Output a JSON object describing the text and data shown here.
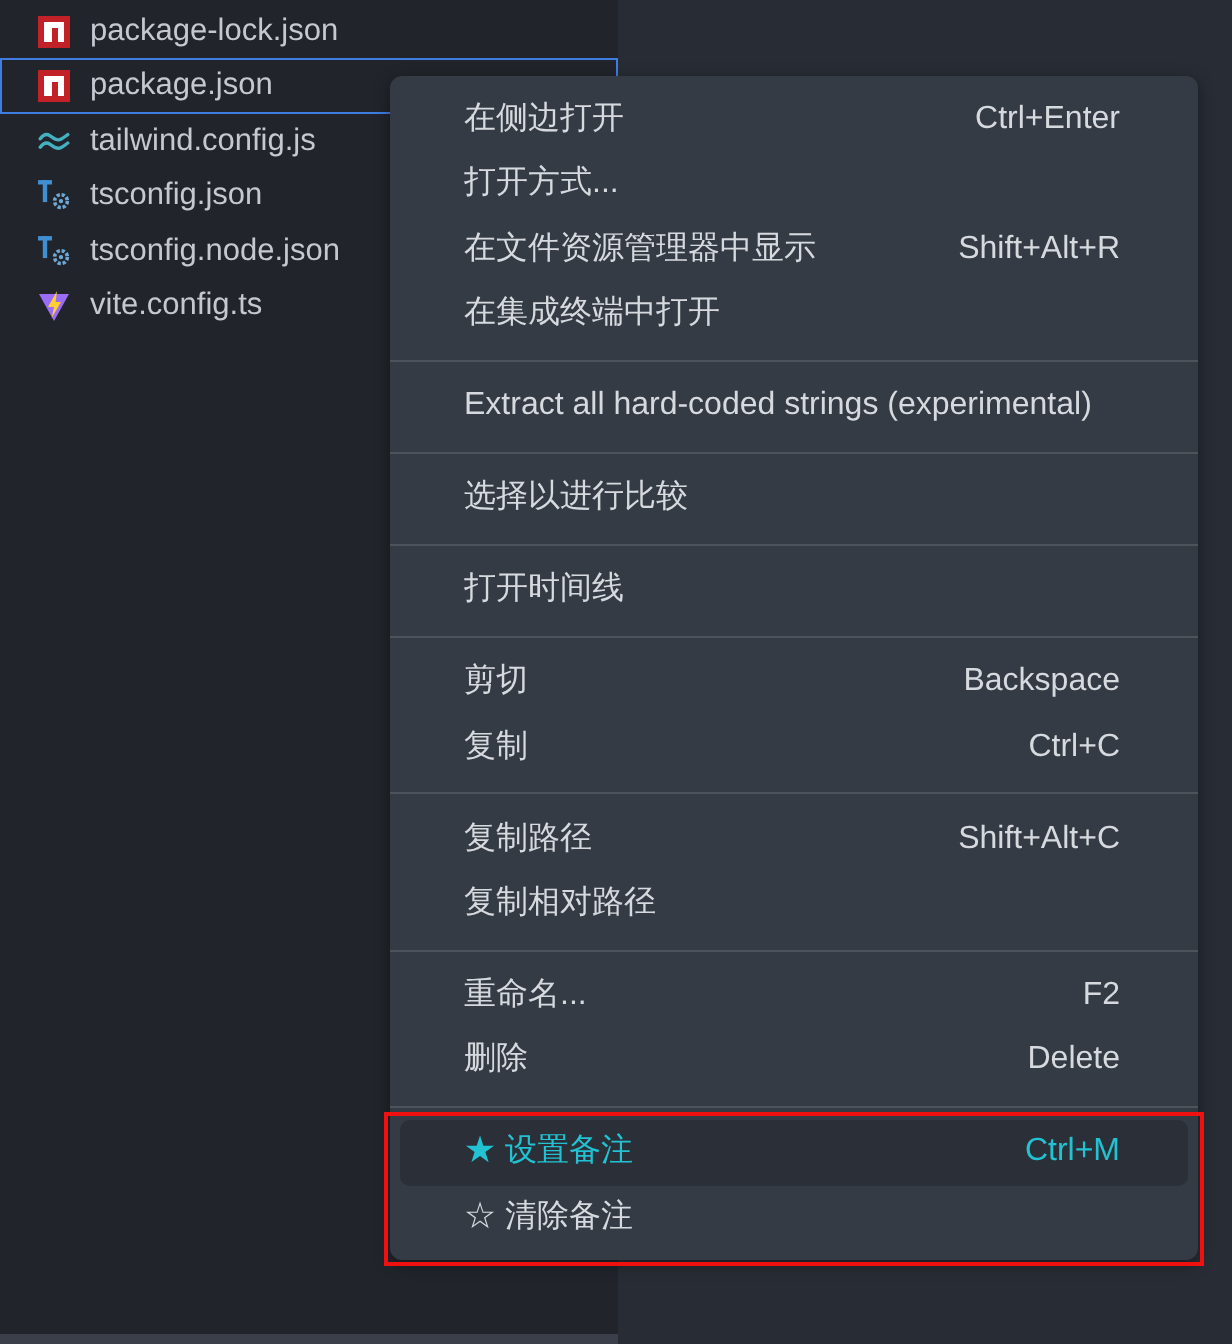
{
  "files": [
    {
      "name": "package-lock.json",
      "kind": "npm",
      "focused": false
    },
    {
      "name": "package.json",
      "kind": "npm",
      "focused": true
    },
    {
      "name": "tailwind.config.js",
      "kind": "tailwind",
      "focused": false
    },
    {
      "name": "tsconfig.json",
      "kind": "tsconfig",
      "focused": false
    },
    {
      "name": "tsconfig.node.json",
      "kind": "tsconfig",
      "focused": false
    },
    {
      "name": "vite.config.ts",
      "kind": "vite",
      "focused": false
    }
  ],
  "context_menu": {
    "groups": [
      {
        "annotated": false,
        "items": [
          {
            "label": "在侧边打开",
            "shortcut": "Ctrl+Enter",
            "selected": false
          },
          {
            "label": "打开方式...",
            "selected": false
          },
          {
            "label": "在文件资源管理器中显示",
            "shortcut": "Shift+Alt+R",
            "selected": false
          },
          {
            "label": "在集成终端中打开",
            "selected": false
          }
        ]
      },
      {
        "annotated": false,
        "items": [
          {
            "label": "Extract all hard-coded strings (experimental)",
            "selected": false
          }
        ]
      },
      {
        "annotated": false,
        "items": [
          {
            "label": "选择以进行比较",
            "selected": false
          }
        ]
      },
      {
        "annotated": false,
        "items": [
          {
            "label": "打开时间线",
            "selected": false
          }
        ]
      },
      {
        "annotated": false,
        "items": [
          {
            "label": "剪切",
            "shortcut": "Backspace",
            "selected": false
          },
          {
            "label": "复制",
            "shortcut": "Ctrl+C",
            "selected": false
          }
        ]
      },
      {
        "annotated": false,
        "items": [
          {
            "label": "复制路径",
            "shortcut": "Shift+Alt+C",
            "selected": false
          },
          {
            "label": "复制相对路径",
            "selected": false
          }
        ]
      },
      {
        "annotated": false,
        "items": [
          {
            "label": "重命名...",
            "shortcut": "F2",
            "selected": false
          },
          {
            "label": "删除",
            "shortcut": "Delete",
            "selected": false
          }
        ]
      },
      {
        "annotated": true,
        "items": [
          {
            "label": "★ 设置备注",
            "shortcut": "Ctrl+M",
            "selected": true
          },
          {
            "label": "☆ 清除备注",
            "selected": false
          }
        ]
      }
    ]
  }
}
